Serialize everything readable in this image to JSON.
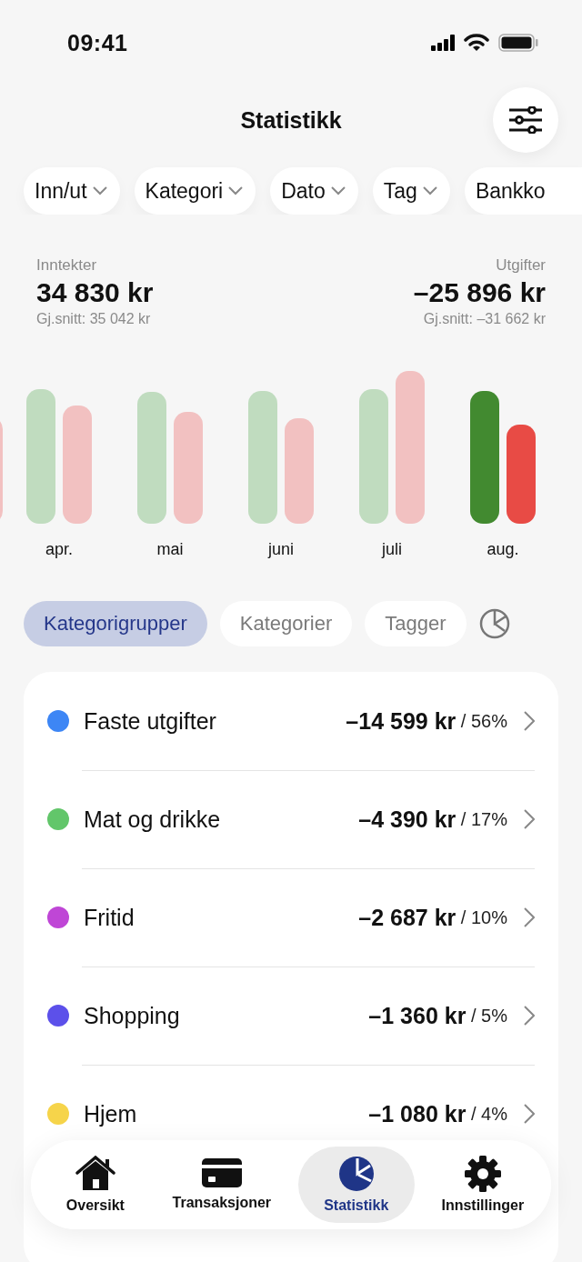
{
  "status_bar": {
    "time": "09:41"
  },
  "header": {
    "title": "Statistikk"
  },
  "filters": [
    {
      "label": "Inn/ut"
    },
    {
      "label": "Kategori"
    },
    {
      "label": "Dato"
    },
    {
      "label": "Tag"
    },
    {
      "label": "Bankko"
    }
  ],
  "summary": {
    "income": {
      "label": "Inntekter",
      "amount": "34 830 kr",
      "average": "Gj.snitt: 35 042 kr"
    },
    "expenses": {
      "label": "Utgifter",
      "amount": "–25 896 kr",
      "average": "Gj.snitt: –31 662 kr"
    }
  },
  "months": [
    {
      "label": "apr.",
      "selected": false
    },
    {
      "label": "mai",
      "selected": false
    },
    {
      "label": "juni",
      "selected": false
    },
    {
      "label": "juli",
      "selected": false
    },
    {
      "label": "aug.",
      "selected": true
    }
  ],
  "segments": [
    {
      "label": "Kategorigrupper",
      "selected": true
    },
    {
      "label": "Kategorier",
      "selected": false
    },
    {
      "label": "Tagger",
      "selected": false
    }
  ],
  "categories": [
    {
      "name": "Faste utgifter",
      "amount": "–14 599 kr",
      "share": "/ 56%",
      "color": "#3d86f5"
    },
    {
      "name": "Mat og drikke",
      "amount": "–4 390 kr",
      "share": "/ 17%",
      "color": "#62c66a"
    },
    {
      "name": "Fritid",
      "amount": "–2 687 kr",
      "share": "/ 10%",
      "color": "#bf46d6"
    },
    {
      "name": "Shopping",
      "amount": "–1 360 kr",
      "share": "/ 5%",
      "color": "#5c50ea"
    },
    {
      "name": "Hjem",
      "amount": "–1 080 kr",
      "share": "/ 4%",
      "color": "#f6d44a"
    }
  ],
  "tab_bar": [
    {
      "label": "Oversikt",
      "selected": false
    },
    {
      "label": "Transaksjoner",
      "selected": false
    },
    {
      "label": "Statistikk",
      "selected": true
    },
    {
      "label": "Innstillinger",
      "selected": false
    }
  ]
}
